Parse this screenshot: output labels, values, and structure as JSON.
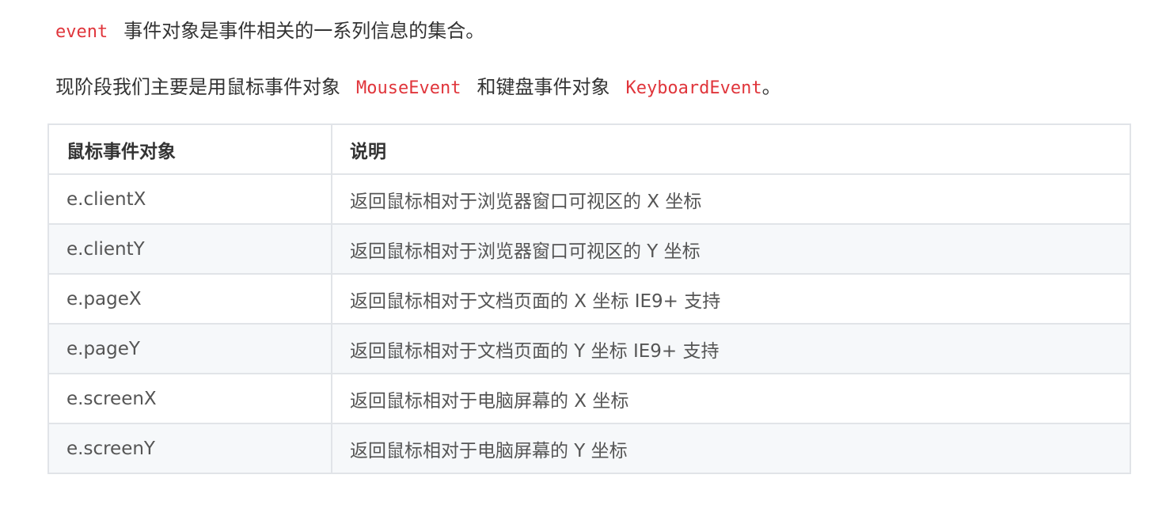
{
  "intro": {
    "code": "event",
    "text": "事件对象是事件相关的一系列信息的集合。"
  },
  "usage": {
    "prefix": "现阶段我们主要是用鼠标事件对象",
    "mouse_code": "MouseEvent",
    "middle": "和键盘事件对象",
    "keyboard_code": "KeyboardEvent",
    "suffix": "。"
  },
  "table": {
    "headers": [
      "鼠标事件对象",
      "说明"
    ],
    "rows": [
      [
        "e.clientX",
        "返回鼠标相对于浏览器窗口可视区的 X 坐标"
      ],
      [
        "e.clientY",
        "返回鼠标相对于浏览器窗口可视区的 Y 坐标"
      ],
      [
        "e.pageX",
        "返回鼠标相对于文档页面的 X 坐标  IE9+ 支持"
      ],
      [
        "e.pageY",
        "返回鼠标相对于文档页面的 Y 坐标  IE9+ 支持"
      ],
      [
        "e.screenX",
        "返回鼠标相对于电脑屏幕的 X 坐标"
      ],
      [
        "e.screenY",
        "返回鼠标相对于电脑屏幕的 Y 坐标"
      ]
    ]
  },
  "colors": {
    "code": "#e0353b",
    "text": "#333333",
    "cell_text": "#555555",
    "border": "#e1e4e8",
    "stripe": "#f6f8fa"
  }
}
